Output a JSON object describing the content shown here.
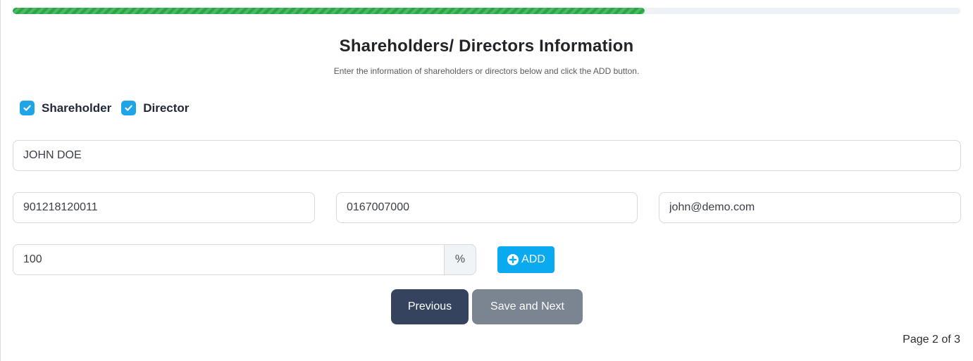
{
  "progress": {
    "percent": 66.7,
    "color": "#28a745"
  },
  "header": {
    "title": "Shareholders/ Directors Information",
    "subtitle": "Enter the information of shareholders or directors below and click the ADD button."
  },
  "roles": [
    {
      "label": "Shareholder",
      "checked": true
    },
    {
      "label": "Director",
      "checked": true
    }
  ],
  "form": {
    "name": "JOHN DOE",
    "ic_number": "901218120011",
    "phone": "0167007000",
    "email": "john@demo.com",
    "share_percent": "100",
    "percent_suffix": "%",
    "add_label": "ADD"
  },
  "nav": {
    "previous_label": "Previous",
    "save_next_label": "Save and Next",
    "page_indicator": "Page 2 of 3"
  },
  "icons": {
    "checkbox": "check-icon",
    "add": "plus-circle-icon"
  },
  "colors": {
    "checkbox": "#1ea5e8",
    "add_button": "#0aaaf0",
    "previous_button": "#35435e",
    "save_next_button": "#7b8491"
  }
}
